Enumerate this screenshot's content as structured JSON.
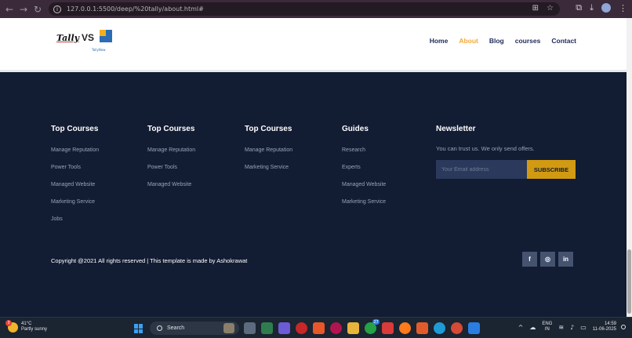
{
  "browser": {
    "url": "127.0.0.1:5500/deep/%20tally/about.html#",
    "icons": [
      "back-arrow-icon",
      "forward-arrow-icon",
      "reload-icon",
      "site-info-icon",
      "translate-icon",
      "bookmark-star-icon",
      "extensions-icon",
      "downloads-icon",
      "profile-icon",
      "kebab-menu-icon"
    ]
  },
  "header": {
    "logo_text": "Tally",
    "logo_vs": "VS",
    "logo_sub": "TallyNow",
    "menu": [
      "Home",
      "About",
      "Blog",
      "courses",
      "Contact"
    ],
    "active_menu": "About",
    "active_color": "#f2a93b"
  },
  "footer": {
    "columns": [
      {
        "title": "Top Courses",
        "links": [
          "Manage Reputation",
          "Power Tools",
          "Managed Website",
          "Marketing Service",
          "Jobs"
        ]
      },
      {
        "title": "Top Courses",
        "links": [
          "Manage Reputation",
          "Power Tools",
          "Managed Website"
        ]
      },
      {
        "title": "Top Courses",
        "links": [
          "Manage Reputation",
          "Marketing Service"
        ]
      },
      {
        "title": "Guides",
        "links": [
          "Research",
          "Experts",
          "Managed Website",
          "Marketing Service"
        ]
      }
    ],
    "newsletter": {
      "title": "Newsletter",
      "text": "You can trust us. We only send offers.",
      "placeholder": "Your Email address",
      "button": "SUBSCRIBE",
      "button_color": "#d19a12"
    },
    "copyright": "Copyright @2021 All rights reserved | This template is made by Ashokrawat",
    "socials": [
      {
        "name": "facebook-icon",
        "glyph": "f"
      },
      {
        "name": "instagram-icon",
        "glyph": "◎"
      },
      {
        "name": "linkedin-icon",
        "glyph": "in"
      }
    ],
    "background": "#121c33"
  },
  "taskbar": {
    "weather_temp": "41°C",
    "weather_desc": "Partly sunny",
    "weather_badge": "3",
    "search_label": "Search",
    "whatsapp_badge": "27",
    "lang_line1": "ENG",
    "lang_line2": "IN",
    "time": "14:59",
    "date": "11-06-2025"
  }
}
